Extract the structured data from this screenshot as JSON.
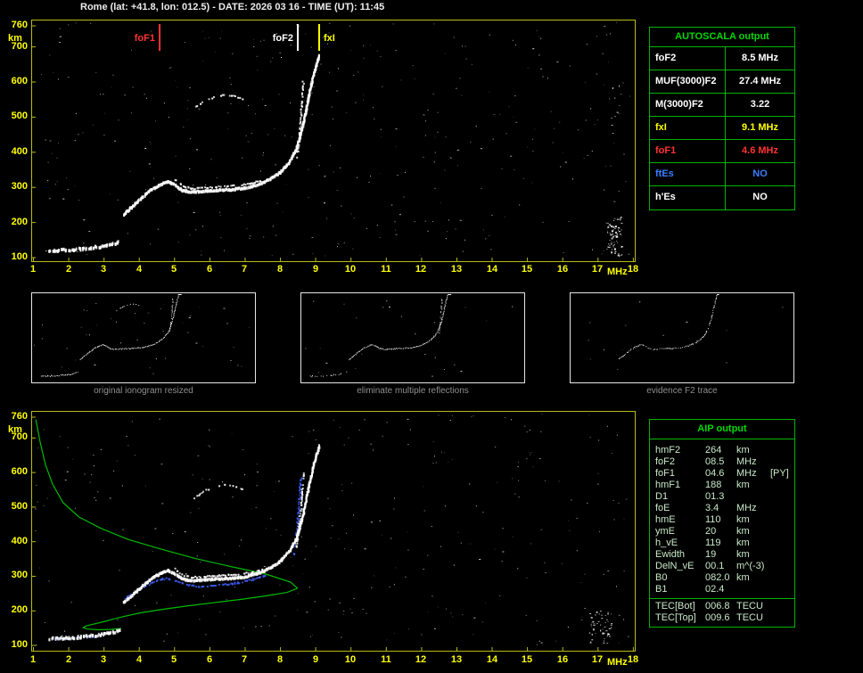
{
  "header": {
    "title": "Rome (lat: +41.8, lon: 012.5) - DATE: 2026 03 16 - TIME (UT): 11:45"
  },
  "colors": {
    "axis": "#ffff00",
    "plot_border": "#b9b918",
    "trace_white": "#ffffff",
    "restored_trace_blue": "#4060ff",
    "profile_green": "#00bb00",
    "table_border_green": "#00b400",
    "table_title_green": "#00d800",
    "caption_gray": "#8f8f8f",
    "aip_text": "#c9e8c9",
    "foF1_red": "#ff3333",
    "fxI_yellow": "#ffff00",
    "ftEs_blue": "#3a7dff"
  },
  "top_plot": {
    "y_axis_unit": "km",
    "x_axis_unit": "MHz",
    "y_ticks": [
      760,
      700,
      600,
      500,
      400,
      300,
      200,
      100
    ],
    "x_ticks": [
      1,
      2,
      3,
      4,
      5,
      6,
      7,
      8,
      9,
      10,
      11,
      12,
      13,
      14,
      15,
      16,
      17,
      18
    ],
    "markers": [
      {
        "label": "foF1",
        "freq_mhz": 4.6,
        "color": "#ff3333",
        "side": "left"
      },
      {
        "label": "foF2",
        "freq_mhz": 8.5,
        "color": "#ffffff",
        "side": "left"
      },
      {
        "label": "fxI",
        "freq_mhz": 9.1,
        "color": "#ffff00",
        "side": "right"
      }
    ]
  },
  "bottom_plot": {
    "y_axis_unit": "km",
    "x_axis_unit": "MHz",
    "y_ticks": [
      760,
      700,
      600,
      500,
      400,
      300,
      200,
      100
    ],
    "x_ticks": [
      1,
      2,
      3,
      4,
      5,
      6,
      7,
      8,
      9,
      10,
      11,
      12,
      13,
      14,
      15,
      16,
      17,
      18
    ]
  },
  "thumbnails": [
    {
      "caption": "original ionogram resized"
    },
    {
      "caption": "eliminate multiple reflections"
    },
    {
      "caption": "evidence F2 trace"
    }
  ],
  "autoscala_table": {
    "title": "AUTOSCALA output",
    "rows": [
      {
        "label": "foF2",
        "value": "8.5 MHz",
        "color": "#ffffff"
      },
      {
        "label": "MUF(3000)F2",
        "value": "27.4 MHz",
        "color": "#ffffff"
      },
      {
        "label": "M(3000)F2",
        "value": "3.22",
        "color": "#ffffff"
      },
      {
        "label": "fxI",
        "value": "9.1 MHz",
        "color": "#ffff00"
      },
      {
        "label": "foF1",
        "value": "4.6 MHz",
        "color": "#ff3333"
      },
      {
        "label": "ftEs",
        "value": "NO",
        "color": "#3a7dff"
      },
      {
        "label": "h'Es",
        "value": "NO",
        "color": "#ffffff"
      }
    ]
  },
  "aip_table": {
    "title": "AIP output",
    "rows": [
      [
        "hmF2",
        "264",
        "km",
        ""
      ],
      [
        "foF2",
        "08.5",
        "MHz",
        ""
      ],
      [
        "foF1",
        "04.6",
        "MHz",
        "[PY]"
      ],
      [
        "hmF1",
        "188",
        "km",
        ""
      ],
      [
        "D1",
        "01.3",
        "",
        ""
      ],
      [
        "foE",
        "3.4",
        "MHz",
        ""
      ],
      [
        "hmE",
        "110",
        "km",
        ""
      ],
      [
        "ymE",
        "20",
        "km",
        ""
      ],
      [
        "h_vE",
        "119",
        "km",
        ""
      ],
      [
        "Ewidth",
        "19",
        "km",
        ""
      ],
      [
        "DelN_vE",
        "00.1",
        "m^(-3)",
        ""
      ],
      [
        "B0",
        "082.0",
        "km",
        ""
      ],
      [
        "B1",
        "02.4",
        "",
        ""
      ]
    ],
    "tec_rows": [
      [
        "TEC[Bot]",
        "006.8",
        "TECU"
      ],
      [
        "TEC[Top]",
        "009.6",
        "TECU"
      ]
    ]
  },
  "chart_data": {
    "type": "scatter",
    "title": "Ionogram with AUTOSCALA autoscaled traces and AIP electron density profile",
    "x_unit": "MHz",
    "y_unit": "km",
    "xlim": [
      1,
      18
    ],
    "ylim": [
      100,
      760
    ],
    "key_values": {
      "foF2_MHz": 8.5,
      "fxI_MHz": 9.1,
      "foF1_MHz": 4.6,
      "hmF2_km": 264,
      "MUF3000F2_MHz": 27.4
    },
    "traces": {
      "e_layer": [
        [
          1.45,
          118
        ],
        [
          1.8,
          120
        ],
        [
          2.2,
          122
        ],
        [
          2.6,
          126
        ],
        [
          3.0,
          131
        ],
        [
          3.3,
          138
        ],
        [
          3.45,
          146
        ]
      ],
      "f_trace": [
        [
          3.55,
          222
        ],
        [
          3.8,
          245
        ],
        [
          4.05,
          268
        ],
        [
          4.3,
          290
        ],
        [
          4.55,
          305
        ],
        [
          4.8,
          316
        ],
        [
          5.0,
          306
        ],
        [
          5.2,
          291
        ],
        [
          5.45,
          286
        ],
        [
          5.8,
          288
        ],
        [
          6.2,
          291
        ],
        [
          6.6,
          293
        ],
        [
          7.0,
          297
        ],
        [
          7.4,
          308
        ],
        [
          7.7,
          323
        ],
        [
          8.0,
          343
        ],
        [
          8.25,
          372
        ],
        [
          8.45,
          410
        ],
        [
          8.6,
          462
        ],
        [
          8.72,
          520
        ],
        [
          8.82,
          570
        ],
        [
          8.92,
          615
        ],
        [
          9.02,
          652
        ],
        [
          9.1,
          678
        ]
      ],
      "f_trace_x": [
        [
          5.0,
          322
        ],
        [
          5.25,
          303
        ],
        [
          5.5,
          298
        ],
        [
          5.9,
          300
        ],
        [
          6.3,
          303
        ],
        [
          6.7,
          306
        ],
        [
          7.1,
          311
        ],
        [
          7.5,
          322
        ]
      ],
      "o_riser": [
        [
          8.45,
          380
        ],
        [
          8.52,
          440
        ],
        [
          8.57,
          500
        ],
        [
          8.61,
          555
        ],
        [
          8.64,
          605
        ]
      ],
      "second_hop": [
        [
          5.55,
          528
        ],
        [
          5.85,
          548
        ],
        [
          6.15,
          560
        ],
        [
          6.45,
          565
        ],
        [
          6.75,
          560
        ],
        [
          6.95,
          550
        ]
      ],
      "blue_e": [
        [
          1.6,
          120
        ],
        [
          2.0,
          122
        ],
        [
          2.4,
          125
        ],
        [
          2.8,
          129
        ]
      ],
      "blue_trace": [
        [
          3.6,
          238
        ],
        [
          3.9,
          258
        ],
        [
          4.2,
          275
        ],
        [
          4.5,
          288
        ],
        [
          4.75,
          295
        ],
        [
          5.0,
          287
        ],
        [
          5.3,
          277
        ],
        [
          5.7,
          272
        ],
        [
          6.1,
          274
        ],
        [
          6.5,
          278
        ],
        [
          6.9,
          284
        ],
        [
          7.3,
          294
        ],
        [
          7.6,
          305
        ]
      ],
      "blue_riser": [
        [
          8.38,
          360
        ],
        [
          8.45,
          420
        ],
        [
          8.5,
          480
        ],
        [
          8.54,
          540
        ],
        [
          8.57,
          590
        ]
      ],
      "profile_top": [
        [
          1.08,
          752
        ],
        [
          1.2,
          688
        ],
        [
          1.35,
          622
        ],
        [
          1.55,
          566
        ],
        [
          1.85,
          512
        ],
        [
          2.3,
          470
        ],
        [
          2.95,
          436
        ],
        [
          3.7,
          405
        ],
        [
          4.6,
          378
        ],
        [
          5.6,
          350
        ],
        [
          6.6,
          327
        ],
        [
          7.6,
          305
        ],
        [
          8.3,
          282
        ],
        [
          8.5,
          264
        ]
      ],
      "profile_bottom": [
        [
          8.5,
          264
        ],
        [
          8.2,
          252
        ],
        [
          7.6,
          242
        ],
        [
          6.9,
          232
        ],
        [
          6.1,
          222
        ],
        [
          5.3,
          212
        ],
        [
          4.6,
          202
        ],
        [
          4.0,
          192
        ],
        [
          3.55,
          182
        ],
        [
          3.2,
          173
        ],
        [
          2.95,
          166
        ],
        [
          2.7,
          160
        ],
        [
          2.5,
          155
        ],
        [
          2.42,
          150
        ],
        [
          2.55,
          146
        ],
        [
          2.85,
          144
        ],
        [
          3.2,
          145
        ],
        [
          3.5,
          148
        ]
      ]
    }
  }
}
